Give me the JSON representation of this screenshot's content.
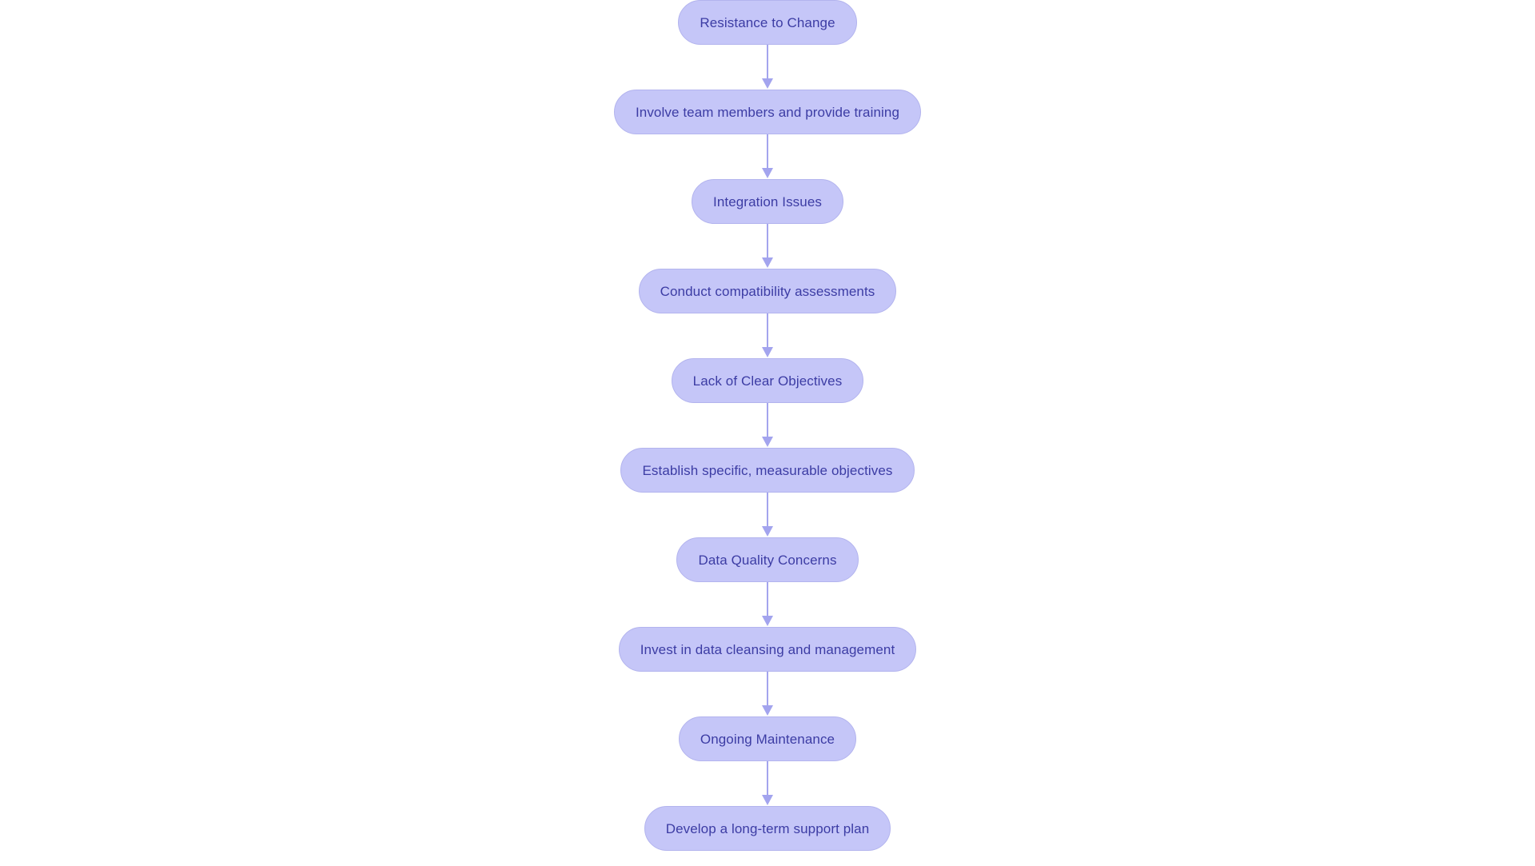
{
  "diagram": {
    "type": "flowchart",
    "orientation": "top-to-bottom",
    "background_color": "#ffffff",
    "node_fill_color": "#c5c6f8",
    "node_border_color": "#b3b4ee",
    "node_text_color": "#3c3ca4",
    "connector_color": "#a3a4ee",
    "nodes": [
      {
        "id": "n1",
        "label": "Resistance to Change",
        "kind": "challenge"
      },
      {
        "id": "n2",
        "label": "Involve team members and provide training",
        "kind": "solution"
      },
      {
        "id": "n3",
        "label": "Integration Issues",
        "kind": "challenge"
      },
      {
        "id": "n4",
        "label": "Conduct compatibility assessments",
        "kind": "solution"
      },
      {
        "id": "n5",
        "label": "Lack of Clear Objectives",
        "kind": "challenge"
      },
      {
        "id": "n6",
        "label": "Establish specific, measurable objectives",
        "kind": "solution"
      },
      {
        "id": "n7",
        "label": "Data Quality Concerns",
        "kind": "challenge"
      },
      {
        "id": "n8",
        "label": "Invest in data cleansing and management",
        "kind": "solution"
      },
      {
        "id": "n9",
        "label": "Ongoing Maintenance",
        "kind": "challenge"
      },
      {
        "id": "n10",
        "label": "Develop a long-term support plan",
        "kind": "solution"
      }
    ],
    "edges": [
      {
        "from": "n1",
        "to": "n2",
        "label": "",
        "arrow": "down"
      },
      {
        "from": "n2",
        "to": "n3",
        "label": "",
        "arrow": "down"
      },
      {
        "from": "n3",
        "to": "n4",
        "label": "",
        "arrow": "down"
      },
      {
        "from": "n4",
        "to": "n5",
        "label": "",
        "arrow": "down"
      },
      {
        "from": "n5",
        "to": "n6",
        "label": "",
        "arrow": "down"
      },
      {
        "from": "n6",
        "to": "n7",
        "label": "",
        "arrow": "down"
      },
      {
        "from": "n7",
        "to": "n8",
        "label": "",
        "arrow": "down"
      },
      {
        "from": "n8",
        "to": "n9",
        "label": "",
        "arrow": "down"
      },
      {
        "from": "n9",
        "to": "n10",
        "label": "",
        "arrow": "down"
      }
    ]
  }
}
